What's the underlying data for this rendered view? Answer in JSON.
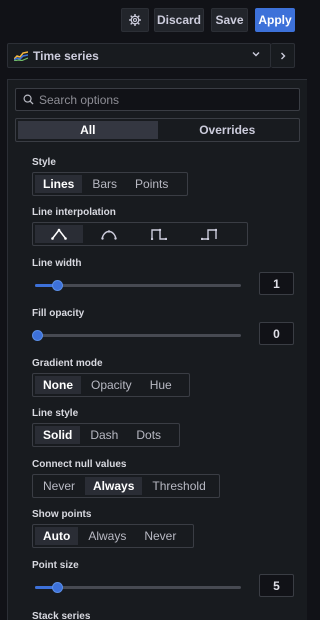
{
  "topbar": {
    "gear_icon": "gear-icon",
    "discard_label": "Discard",
    "save_label": "Save",
    "apply_label": "Apply"
  },
  "viz_picker": {
    "label": "Time series",
    "icon": "timeseries-icon",
    "chevron_icon": "chevron-down-icon",
    "collapse_icon": "chevron-right-icon"
  },
  "search": {
    "placeholder": "Search options",
    "value": ""
  },
  "tabs": [
    {
      "label": "All",
      "active": true
    },
    {
      "label": "Overrides",
      "active": false
    }
  ],
  "options": {
    "style": {
      "label": "Style",
      "choices": [
        "Lines",
        "Bars",
        "Points"
      ],
      "selected": "Lines"
    },
    "line_interpolation": {
      "label": "Line interpolation",
      "choices": [
        "linear-icon",
        "smooth-icon",
        "step-before-icon",
        "step-after-icon"
      ],
      "selected": "linear-icon"
    },
    "line_width": {
      "label": "Line width",
      "value": "1",
      "min": 0,
      "max": 10,
      "level": 0.1
    },
    "fill_opacity": {
      "label": "Fill opacity",
      "value": "0",
      "min": 0,
      "max": 100,
      "level": 0
    },
    "gradient_mode": {
      "label": "Gradient mode",
      "choices": [
        "None",
        "Opacity",
        "Hue"
      ],
      "selected": "None"
    },
    "line_style": {
      "label": "Line style",
      "choices": [
        "Solid",
        "Dash",
        "Dots"
      ],
      "selected": "Solid"
    },
    "connect_null": {
      "label": "Connect null values",
      "choices": [
        "Never",
        "Always",
        "Threshold"
      ],
      "selected": "Always"
    },
    "show_points": {
      "label": "Show points",
      "choices": [
        "Auto",
        "Always",
        "Never"
      ],
      "selected": "Auto"
    },
    "point_size": {
      "label": "Point size",
      "value": "5",
      "min": 1,
      "max": 40,
      "level": 0.1
    },
    "stack_series": {
      "label": "Stack series"
    }
  },
  "colors": {
    "accent": "#3d71d9",
    "background": "#111217",
    "panel": "#181b1f"
  }
}
